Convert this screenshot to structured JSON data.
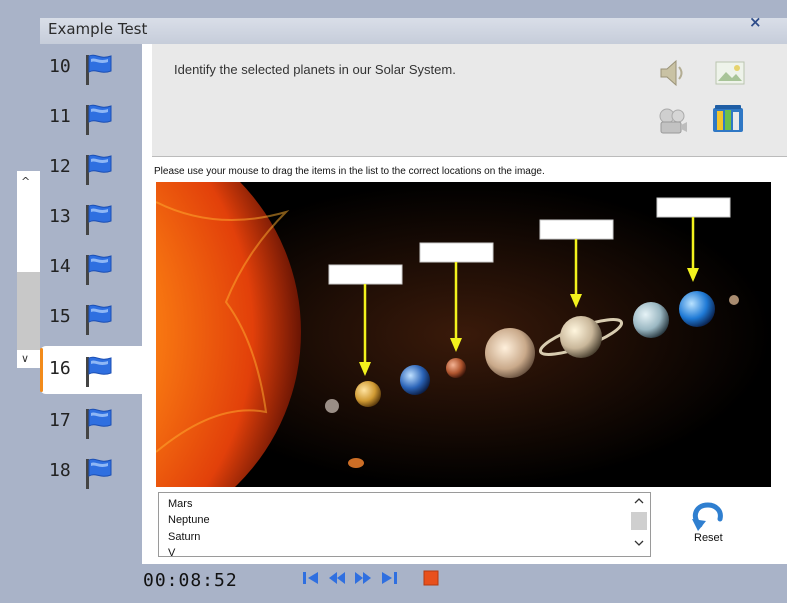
{
  "window": {
    "title": "Example Test",
    "close_label": "×"
  },
  "questions": [
    {
      "number": "10",
      "active": false
    },
    {
      "number": "11",
      "active": false
    },
    {
      "number": "12",
      "active": false
    },
    {
      "number": "13",
      "active": false
    },
    {
      "number": "14",
      "active": false
    },
    {
      "number": "15",
      "active": false
    },
    {
      "number": "16",
      "active": true
    },
    {
      "number": "17",
      "active": false
    },
    {
      "number": "18",
      "active": false
    }
  ],
  "question": {
    "text": "Identify the selected planets in our Solar System.",
    "instruction": "Please use your mouse to drag the items in the list to the correct locations on the image."
  },
  "tools": [
    "speaker-icon",
    "image-icon",
    "video-icon",
    "books-icon"
  ],
  "drag_items": [
    "Mars",
    "Neptune",
    "Saturn",
    "V"
  ],
  "reset_label": "Reset",
  "timer": "00:08:52",
  "controls": [
    "first-icon",
    "previous-icon",
    "next-icon",
    "last-icon",
    "stop-icon"
  ],
  "colors": {
    "accent": "#f28b1b",
    "flag": "#2f6fe0",
    "arrow": "#f2f21d",
    "background": "#a9b3c8"
  }
}
